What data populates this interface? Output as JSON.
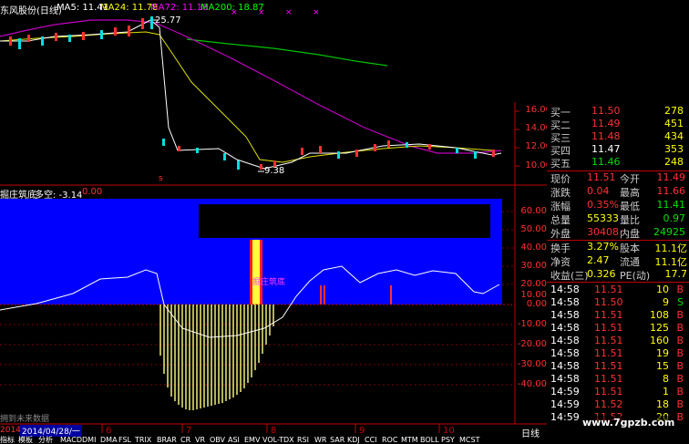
{
  "main_header": {
    "stock_title": "东风股份(日线)",
    "ma5": "MA5: 11.41",
    "ma24": "MA24: 11.78",
    "ma72": "MA72: 11.18",
    "ma200": "MA200: 18.87",
    "high_marker": "25.77",
    "low_marker": "9.38"
  },
  "price_axis": [
    "16.00",
    "14.00",
    "12.00",
    "10.00"
  ],
  "indicator_header": {
    "name": "掘庄筑底",
    "long_short": "多空: -3.14",
    "value": "0.00",
    "signal_label": "掘庄筑底"
  },
  "indicator_axis": [
    "60.00",
    "50.00",
    "40.00",
    "30.00",
    "20.00",
    "10.00",
    "0.00",
    "-10.00",
    "-20.00",
    "-30.00",
    "-40.00"
  ],
  "date_axis": {
    "year_label": "2014",
    "date_box": "2014/04/28/一",
    "ticks": [
      "6",
      "7",
      "8",
      "9",
      "10"
    ],
    "future_data": "拥到未来数据",
    "period": "日线"
  },
  "order_book": [
    {
      "label": "买一",
      "price": "11.50",
      "vol": "278"
    },
    {
      "label": "买二",
      "price": "11.49",
      "vol": "451"
    },
    {
      "label": "买三",
      "price": "11.48",
      "vol": "434"
    },
    {
      "label": "买四",
      "price": "11.47",
      "vol": "353"
    },
    {
      "label": "买五",
      "price": "11.46",
      "vol": "248"
    }
  ],
  "quote": [
    {
      "l1": "现价",
      "v1": "11.51",
      "l2": "今开",
      "v2": "11.49"
    },
    {
      "l1": "涨跌",
      "v1": "0.04",
      "l2": "最高",
      "v2": "11.66"
    },
    {
      "l1": "涨幅",
      "v1": "0.35%",
      "l2": "最低",
      "v2": "11.41"
    },
    {
      "l1": "总量",
      "v1": "55333",
      "l2": "量比",
      "v2": "0.97"
    },
    {
      "l1": "外盘",
      "v1": "30408",
      "l2": "内盘",
      "v2": "24925"
    }
  ],
  "quote2": [
    {
      "l1": "换手",
      "v1": "3.27%",
      "l2": "股本",
      "v2": "11.1亿"
    },
    {
      "l1": "净资",
      "v1": "2.47",
      "l2": "流通",
      "v2": "11.1亿"
    },
    {
      "l1": "收益(三)",
      "v1": "0.326",
      "l2": "PE(动)",
      "v2": "17.7"
    }
  ],
  "ticks": [
    {
      "time": "14:58",
      "price": "11.51",
      "vol": "10",
      "side": "B"
    },
    {
      "time": "14:58",
      "price": "11.50",
      "vol": "9",
      "side": "S"
    },
    {
      "time": "14:58",
      "price": "11.51",
      "vol": "108",
      "side": "B"
    },
    {
      "time": "14:58",
      "price": "11.51",
      "vol": "125",
      "side": "B"
    },
    {
      "time": "14:58",
      "price": "11.51",
      "vol": "160",
      "side": "B"
    },
    {
      "time": "14:58",
      "price": "11.51",
      "vol": "19",
      "side": "B"
    },
    {
      "time": "14:58",
      "price": "11.51",
      "vol": "15",
      "side": "B"
    },
    {
      "time": "14:58",
      "price": "11.51",
      "vol": "8",
      "side": "B"
    },
    {
      "time": "14:59",
      "price": "11.51",
      "vol": "1",
      "side": "B"
    },
    {
      "time": "14:59",
      "price": "11.52",
      "vol": "18",
      "side": "B"
    },
    {
      "time": "14:59",
      "price": "11.52",
      "vol": "20",
      "side": "B"
    }
  ],
  "bottom_tabs": [
    "指标",
    "模板",
    "分析",
    "MACD",
    "DMI",
    "DMA",
    "FSL",
    "TRIX",
    "BRAR",
    "CR",
    "VR",
    "OBV",
    "ASI",
    "EMV",
    "VOL-TDX",
    "RSI",
    "WR",
    "SAR",
    "KDJ",
    "CCI",
    "ROC",
    "MTM",
    "BOLL",
    "PSY",
    "MCST"
  ],
  "watermark": "www.7gpzb.com",
  "colors": {
    "up": "#ff3030",
    "down": "#00e0e0",
    "flat": "#ffffff",
    "ma5": "#ffffff",
    "ma24": "#ffff00",
    "ma72": "#ff00ff",
    "ma200": "#00ff00",
    "indicator_bg": "#0000ff"
  }
}
